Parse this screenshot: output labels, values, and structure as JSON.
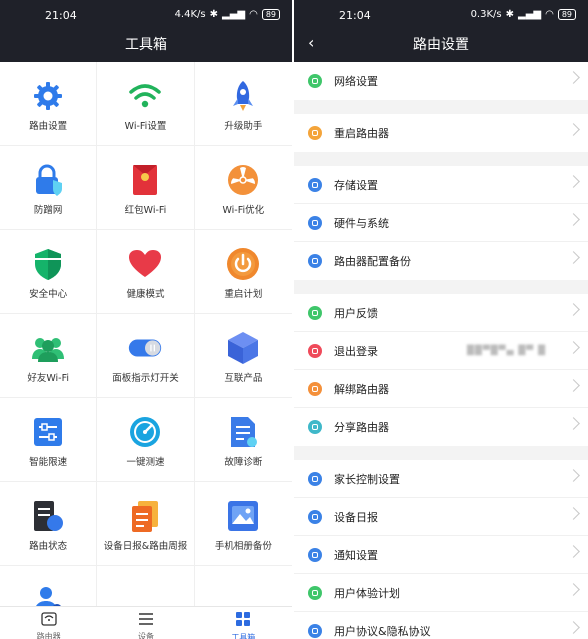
{
  "left": {
    "status": {
      "time": "21:04",
      "speed": "4.4K/s",
      "battery": "89"
    },
    "title": "工具箱",
    "tools": [
      [
        "路由设置",
        "Wi-Fi设置",
        "升级助手"
      ],
      [
        "防蹭网",
        "红包Wi-Fi",
        "Wi-Fi优化"
      ],
      [
        "安全中心",
        "健康模式",
        "重启计划"
      ],
      [
        "好友Wi-Fi",
        "面板指示灯开关",
        "互联产品"
      ],
      [
        "智能限速",
        "一键测速",
        "故障诊断"
      ],
      [
        "路由状态",
        "设备日报&路由周报",
        "手机相册备份"
      ],
      [
        ""
      ]
    ],
    "icon_names": [
      [
        "gear-icon",
        "wifi-icon",
        "rocket-icon"
      ],
      [
        "lock-shield-icon",
        "red-envelope-icon",
        "fan-icon"
      ],
      [
        "shield-icon",
        "heart-icon",
        "power-icon"
      ],
      [
        "friends-icon",
        "toggle-icon",
        "cube-icon"
      ],
      [
        "sliders-icon",
        "speedometer-icon",
        "diagnosis-doc-icon"
      ],
      [
        "status-doc-icon",
        "report-icon",
        "photo-backup-icon"
      ],
      [
        "user-icon"
      ]
    ],
    "tabs": [
      {
        "label": "路由器",
        "icon": "router-icon"
      },
      {
        "label": "设备",
        "icon": "menu-icon"
      },
      {
        "label": "工具箱",
        "icon": "grid-icon"
      }
    ]
  },
  "right": {
    "status": {
      "time": "21:04",
      "speed": "0.3K/s",
      "battery": "89"
    },
    "title": "路由设置",
    "back_glyph": "‹",
    "sections": [
      [
        {
          "label": "网络设置",
          "color": "#3fc66a"
        }
      ],
      [
        {
          "label": "重启路由器",
          "color": "#f4a43a"
        }
      ],
      [
        {
          "label": "存储设置",
          "color": "#3b82e6"
        },
        {
          "label": "硬件与系统",
          "color": "#3b82e6"
        },
        {
          "label": "路由器配置备份",
          "color": "#3b82e6"
        }
      ],
      [
        {
          "label": "用户反馈",
          "color": "#3fc66a"
        },
        {
          "label": "退出登录",
          "color": "#ef4a5a",
          "extra": "██▀█▀▄ █▀ █"
        },
        {
          "label": "解绑路由器",
          "color": "#f4903a"
        },
        {
          "label": "分享路由器",
          "color": "#3fb8c9"
        }
      ],
      [
        {
          "label": "家长控制设置",
          "color": "#3b82e6"
        },
        {
          "label": "设备日报",
          "color": "#3b82e6"
        },
        {
          "label": "通知设置",
          "color": "#3b82e6"
        },
        {
          "label": "用户体验计划",
          "color": "#3fc66a"
        },
        {
          "label": "用户协议&隐私协议",
          "color": "#3b82e6"
        }
      ]
    ]
  }
}
